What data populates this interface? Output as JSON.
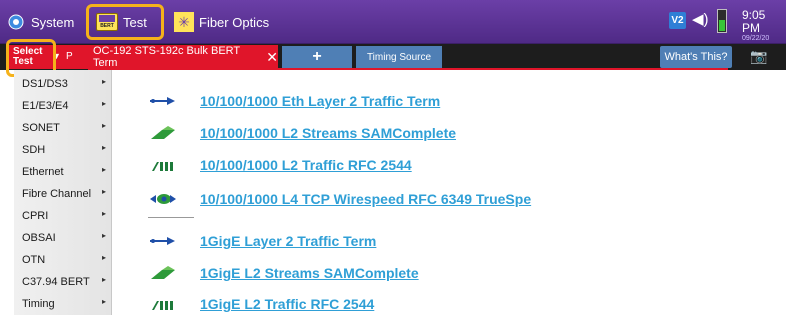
{
  "topbar": {
    "system_label": "System",
    "test_label": "Test",
    "test_icon_text": "BERT",
    "fiber_label": "Fiber Optics",
    "v2_label": "V2",
    "time": "9:05 PM",
    "date": "09/22/20"
  },
  "tabbar": {
    "select_test_line1": "Select",
    "select_test_line2": "Test",
    "select_fragment": "P",
    "active_tab": "OC-192 STS-192c Bulk BERT Term",
    "plus_label": "+",
    "timing_source": "Timing Source",
    "whats_this": "What's This?"
  },
  "sidebar": {
    "items": [
      {
        "label": "DS1/DS3"
      },
      {
        "label": "E1/E3/E4"
      },
      {
        "label": "SONET"
      },
      {
        "label": "SDH"
      },
      {
        "label": "Ethernet"
      },
      {
        "label": "Fibre Channel"
      },
      {
        "label": "CPRI"
      },
      {
        "label": "OBSAI"
      },
      {
        "label": "OTN"
      },
      {
        "label": "C37.94 BERT"
      },
      {
        "label": "Timing"
      }
    ]
  },
  "tests": [
    {
      "label": "10/100/1000 Eth Layer 2 Traffic Term",
      "icon": "arrow-icon"
    },
    {
      "label": "10/100/1000 L2 Streams SAMComplete",
      "icon": "streams-icon"
    },
    {
      "label": "10/100/1000 L2 Traffic RFC 2544",
      "icon": "bars-icon"
    },
    {
      "label": "10/100/1000 L4 TCP Wirespeed RFC 6349 TrueSpe",
      "icon": "eye-icon"
    },
    {
      "label": "1GigE Layer 2 Traffic Term",
      "icon": "arrow-icon"
    },
    {
      "label": "1GigE L2 Streams SAMComplete",
      "icon": "streams-icon"
    },
    {
      "label": "1GigE L2 Traffic RFC 2544",
      "icon": "bars-icon"
    }
  ],
  "colors": {
    "topbar": "#5a3195",
    "accent_red": "#e0152a",
    "tab_blue": "#4f7fb5",
    "link_blue": "#2f9fd6",
    "highlight": "#f5b21b"
  }
}
